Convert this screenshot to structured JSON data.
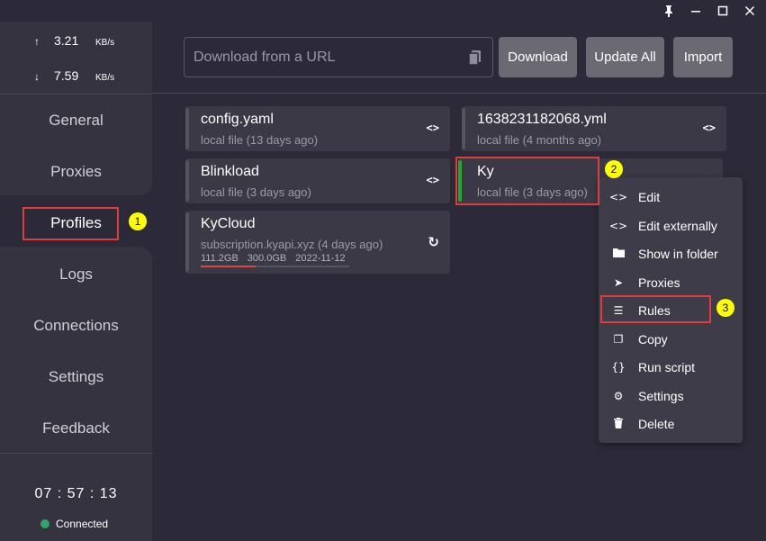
{
  "window_controls": {
    "pin": "pin-icon",
    "minimize": "minimize-icon",
    "maximize": "maximize-icon",
    "close": "close-icon"
  },
  "traffic": {
    "upload_arrow": "↑",
    "upload_value": "3.21",
    "upload_unit": "KB/s",
    "download_arrow": "↓",
    "download_value": "7.59",
    "download_unit": "KB/s"
  },
  "nav": {
    "items": [
      {
        "label": "General"
      },
      {
        "label": "Proxies"
      },
      {
        "label": "Profiles"
      },
      {
        "label": "Logs"
      },
      {
        "label": "Connections"
      },
      {
        "label": "Settings"
      },
      {
        "label": "Feedback"
      }
    ],
    "selected": "Profiles"
  },
  "clock": "07 : 57 : 13",
  "connection_status": "Connected",
  "toolbar": {
    "url_placeholder": "Download from a URL",
    "download_label": "Download",
    "update_all_label": "Update All",
    "import_label": "Import"
  },
  "profiles": [
    {
      "title": "config.yaml",
      "subtitle": "local file (13 days ago)",
      "action": "<>"
    },
    {
      "title": "1638231182068.yml",
      "subtitle": "local file (4 months ago)",
      "action": "<>"
    },
    {
      "title": "Blinkload",
      "subtitle": "local file (3 days ago)",
      "action": "<>"
    },
    {
      "title": "Ky",
      "subtitle": "local file (3 days ago)",
      "action": "<>",
      "active": true
    },
    {
      "title": "KyCloud",
      "subtitle": "subscription.kyapi.xyz (4 days ago)",
      "action": "↻",
      "used": "111.2GB",
      "total": "300.0GB",
      "expires": "2022-11-12",
      "usage_fraction": 0.37
    }
  ],
  "context_menu": {
    "items": [
      {
        "icon": "<>",
        "label": "Edit"
      },
      {
        "icon": "<>",
        "label": "Edit externally"
      },
      {
        "icon": "■",
        "label": "Show in folder"
      },
      {
        "icon": "➤",
        "label": "Proxies"
      },
      {
        "icon": "☰",
        "label": "Rules"
      },
      {
        "icon": "❐",
        "label": "Copy"
      },
      {
        "icon": "{}",
        "label": "Run script"
      },
      {
        "icon": "⚙",
        "label": "Settings"
      },
      {
        "icon": "🗑",
        "label": "Delete"
      }
    ]
  },
  "annotations": {
    "step1": "1",
    "step2": "2",
    "step3": "3"
  },
  "colors": {
    "active_bar": "#2aa52a",
    "annotation_box": "#e03c3c",
    "annotation_badge": "#ffff00",
    "connected_dot": "#2ea56a"
  }
}
